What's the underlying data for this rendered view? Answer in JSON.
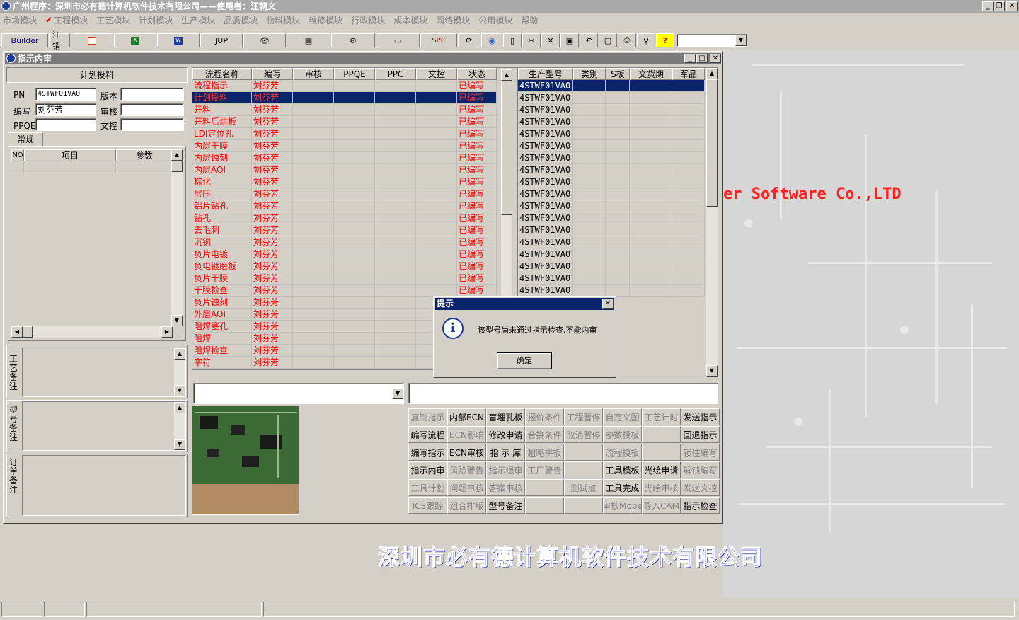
{
  "app": {
    "title": "广州程序：深圳市必有德计算机软件技术有限公司——使用者：汪朝文"
  },
  "menu": [
    "市场模块",
    "工程模块",
    "工艺模块",
    "计划模块",
    "生产模块",
    "品质模块",
    "物料模块",
    "维修模块",
    "行政模块",
    "成本模块",
    "网络模块",
    "公用模块",
    "帮助"
  ],
  "toolbar": {
    "builder": "Builder",
    "logout": "注销",
    "jup": "JUP",
    "spc": "SPC"
  },
  "window": {
    "title": "指示内审"
  },
  "left": {
    "section_title": "计划投料",
    "pn_label": "PN",
    "pn_value": "4STWF01VA0",
    "version_label": "版本",
    "version_value": "",
    "author_label": "编写",
    "author_value": "刘芬芳",
    "review_label": "审核",
    "review_value": "",
    "ppqe_label": "PPQE",
    "ppqe_value": "",
    "doc_label": "文控",
    "doc_value": "",
    "tab": "常规",
    "params_headers": [
      "NO",
      "项目",
      "参数"
    ],
    "notes": [
      "工艺备注",
      "型号备注",
      "订单备注"
    ]
  },
  "flow": {
    "headers": [
      "流程名称",
      "编写",
      "审核",
      "PPQE",
      "PPC",
      "文控",
      "状态"
    ],
    "rows": [
      [
        "流程指示",
        "刘芬芳",
        "已编写"
      ],
      [
        "计划投料",
        "刘芬芳",
        "已编写"
      ],
      [
        "开料",
        "刘芬芳",
        "已编写"
      ],
      [
        "开料后烘板",
        "刘芬芳",
        "已编写"
      ],
      [
        "LDI定位孔",
        "刘芬芳",
        "已编写"
      ],
      [
        "内层干膜",
        "刘芬芳",
        "已编写"
      ],
      [
        "内层蚀刻",
        "刘芬芳",
        "已编写"
      ],
      [
        "内层AOI",
        "刘芬芳",
        "已编写"
      ],
      [
        "棕化",
        "刘芬芳",
        "已编写"
      ],
      [
        "层压",
        "刘芬芳",
        "已编写"
      ],
      [
        "铝片钻孔",
        "刘芬芳",
        "已编写"
      ],
      [
        "钻孔",
        "刘芬芳",
        "已编写"
      ],
      [
        "去毛刺",
        "刘芬芳",
        "已编写"
      ],
      [
        "沉铜",
        "刘芬芳",
        "已编写"
      ],
      [
        "负片电镀",
        "刘芬芳",
        "已编写"
      ],
      [
        "负电镀磨板",
        "刘芬芳",
        "已编写"
      ],
      [
        "负片干膜",
        "刘芬芳",
        "已编写"
      ],
      [
        "干膜检查",
        "刘芬芳",
        "已编写"
      ],
      [
        "负片蚀刻",
        "刘芬芳",
        ""
      ],
      [
        "外层AOI",
        "刘芬芳",
        ""
      ],
      [
        "阻焊塞孔",
        "刘芬芳",
        ""
      ],
      [
        "阻焊",
        "刘芬芳",
        ""
      ],
      [
        "阻焊检查",
        "刘芬芳",
        ""
      ],
      [
        "字符",
        "刘芬芳",
        ""
      ]
    ]
  },
  "models": {
    "headers": [
      "生产型号",
      "类别",
      "S板",
      "交货期",
      "军品"
    ],
    "rows": [
      "4STWF01VA0",
      "4STWF01VA0",
      "4STWF01VA0",
      "4STWF01VA0",
      "4STWF01VA0",
      "4STWF01VA0",
      "4STWF01VA0",
      "4STWF01VA0",
      "4STWF01VA0",
      "4STWF01VA0",
      "4STWF01VA0",
      "4STWF01VA0",
      "4STWF01VA0",
      "4STWF01VA0",
      "4STWF01VA0",
      "4STWF01VA0",
      "4STWF01VA0",
      "4STWF01VA0"
    ]
  },
  "actions": [
    [
      "复制指示",
      "内部ECN",
      "盲埋孔板",
      "报价条件",
      "工程暂停",
      "自定义图",
      "工艺计时",
      "发送指示"
    ],
    [
      "编写流程",
      "ECN影响",
      "修改申请",
      "合拼条件",
      "取消暂停",
      "参数模板",
      "",
      "回退指示"
    ],
    [
      "编写指示",
      "ECN审核",
      "指 示 库",
      "粗略拼板",
      "",
      "流程模板",
      "",
      "锁住编写"
    ],
    [
      "指示内审",
      "风险警告",
      "指示退审",
      "工厂警告",
      "",
      "工具模板",
      "光绘申请",
      "解锁编写"
    ],
    [
      "工具计划",
      "问题审核",
      "答案审核",
      "",
      "测试点",
      "工具完成",
      "光绘审核",
      "发送文控"
    ],
    [
      "ICS跟踪",
      "组合排版",
      "型号备注",
      "",
      "",
      "审核Mope",
      "导入CAM",
      "指示检查"
    ]
  ],
  "actions_disabled": [
    [
      true,
      false,
      false,
      true,
      true,
      true,
      true,
      false
    ],
    [
      false,
      true,
      false,
      true,
      true,
      true,
      false,
      false
    ],
    [
      false,
      false,
      false,
      true,
      false,
      true,
      false,
      true
    ],
    [
      false,
      true,
      true,
      true,
      false,
      false,
      false,
      true
    ],
    [
      true,
      true,
      true,
      false,
      true,
      false,
      true,
      true
    ],
    [
      true,
      true,
      false,
      false,
      false,
      true,
      true,
      false
    ]
  ],
  "dialog": {
    "title": "提示",
    "message": "该型号尚未通过指示检查,不能内审",
    "ok": "确定"
  },
  "background": {
    "company_en": "er Software Co.,LTD",
    "company_cn": "深圳市必有德计算机软件技术有限公司"
  },
  "colors": {
    "selection": "#0a246a",
    "status_red": "#ff0000",
    "dialog_title": "#0a246a"
  }
}
